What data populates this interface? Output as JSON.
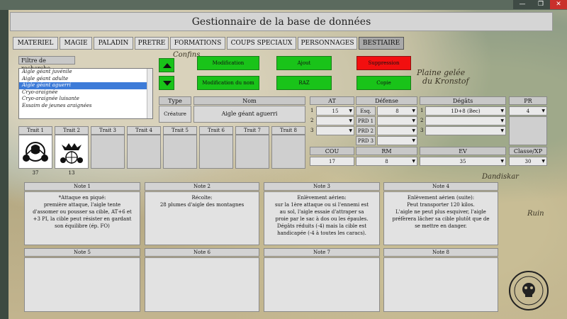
{
  "window": {
    "title": "Gestionnaire de la base de données",
    "minimize_icon": "minimize-icon",
    "maximize_icon": "maximize-icon",
    "close_icon": "close-icon",
    "minimize_glyph": "—",
    "maximize_glyph": "❐",
    "close_glyph": "✕"
  },
  "tabs": [
    {
      "label": "MATERIEL"
    },
    {
      "label": "MAGIE"
    },
    {
      "label": "PALADIN"
    },
    {
      "label": "PRETRE"
    },
    {
      "label": "FORMATIONS"
    },
    {
      "label": "COUPS SPECIAUX"
    },
    {
      "label": "PERSONNAGES"
    },
    {
      "label": "BESTIAIRE",
      "active": true
    }
  ],
  "search": {
    "filter_label": "Filtre de recherche",
    "items": [
      "Aigle géant juvénile",
      "Aigle géant adulte",
      "Aigle géant aguerri",
      "Cryo-araignée",
      "Cryo-araignée luisante",
      "Essaim de jeunes araignées"
    ],
    "selected_index": 2
  },
  "actions": {
    "modification": "Modification",
    "modification_nom": "Modification du nom",
    "ajout": "Ajout",
    "raz": "RAZ",
    "suppression": "Suppression",
    "copie": "Copie"
  },
  "table": {
    "type_header": "Type",
    "nom_header": "Nom",
    "type_value": "Créature",
    "nom_value": "Aigle géant aguerri",
    "at_header": "AT",
    "defense_header": "Défense",
    "degats_header": "Dégâts",
    "pr_header": "PR",
    "at_rows": [
      {
        "n": "1",
        "value": "15"
      },
      {
        "n": "2",
        "value": ""
      },
      {
        "n": "3",
        "value": ""
      }
    ],
    "defense_rows": [
      {
        "label": "Esq.",
        "value": "8"
      },
      {
        "label": "PRD 1",
        "value": ""
      },
      {
        "label": "PRD 2",
        "value": ""
      },
      {
        "label": "PRD 3",
        "value": ""
      }
    ],
    "degats_rows": [
      {
        "n": "1",
        "value": "1D+8 (Bec)"
      },
      {
        "n": "2",
        "value": ""
      },
      {
        "n": "3",
        "value": ""
      }
    ],
    "pr_value": "4",
    "cou_header": "COU",
    "rm_header": "RM",
    "ev_header": "EV",
    "classe_header": "Classe/XP",
    "cou_value": "17",
    "rm_value": "8",
    "ev_value": "35",
    "classe_value": "30"
  },
  "traits": [
    {
      "label": "Trait 1",
      "value": "37",
      "icon": "fist-scales-icon"
    },
    {
      "label": "Trait 2",
      "value": "13",
      "icon": "bird-target-icon"
    },
    {
      "label": "Trait 3",
      "value": ""
    },
    {
      "label": "Trait 4",
      "value": ""
    },
    {
      "label": "Trait 5",
      "value": ""
    },
    {
      "label": "Trait 6",
      "value": ""
    },
    {
      "label": "Trait 7",
      "value": ""
    },
    {
      "label": "Trait 8",
      "value": ""
    }
  ],
  "notes": [
    {
      "label": "Note 1",
      "lines": [
        "*Attaque en piqué:",
        "première attaque, l'aigle tente",
        "d'assomer ou pousser sa cible, AT+6 et",
        "+3 PI, la cible peut résister en gardant",
        "son équilibre (ép. FO)"
      ]
    },
    {
      "label": "Note 2",
      "lines": [
        "Récolte:",
        "28 plumes d'aigle des montagnes"
      ]
    },
    {
      "label": "Note 3",
      "lines": [
        "Enlèvement aérien:",
        "sur la 1ère attaque ou si l'ennemi est",
        "au sol, l'aigle essaie d'attraper sa",
        "proie par le sac à dos ou les épaules.",
        "Dégâts réduits (-4) mais la cible est",
        "handicapée (-4 à toutes les caracs)."
      ]
    },
    {
      "label": "Note 4",
      "lines": [
        "Enlèvement aérien (suite):",
        "Peut transporter 120 kilos.",
        "L'aigle ne peut plus esquiver, l'aigle",
        "préfèrera lâcher sa cible plutôt que de",
        "se mettre en danger."
      ]
    },
    {
      "label": "Note 5",
      "lines": []
    },
    {
      "label": "Note 6",
      "lines": []
    },
    {
      "label": "Note 7",
      "lines": []
    },
    {
      "label": "Note 8",
      "lines": []
    }
  ],
  "map_labels": {
    "plaine": "Plaine gelée",
    "plaine2": "du Kronstof",
    "dandiskar": "Dandiskar",
    "ruin": "Ruin",
    "confins": "Confins"
  },
  "colors": {
    "green_button": "#19c319",
    "red_button": "#f20f0f",
    "selection": "#3d7bd8",
    "panel": "#d6d6d6"
  }
}
